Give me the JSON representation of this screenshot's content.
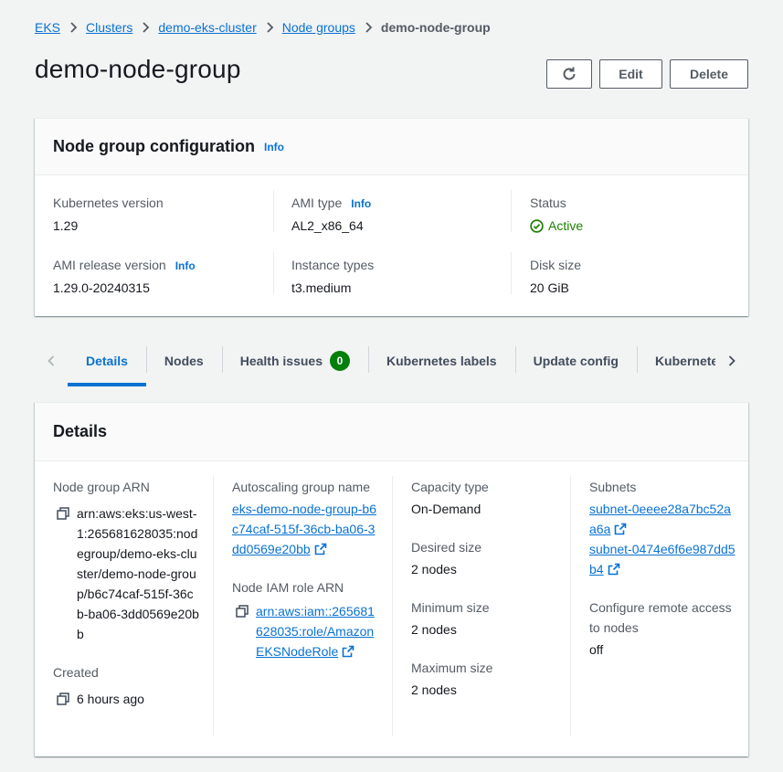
{
  "breadcrumb": {
    "items": [
      "EKS",
      "Clusters",
      "demo-eks-cluster",
      "Node groups"
    ],
    "current": "demo-node-group"
  },
  "header": {
    "title": "demo-node-group",
    "edit_label": "Edit",
    "delete_label": "Delete",
    "refresh_icon": "refresh-icon"
  },
  "config": {
    "title": "Node group configuration",
    "info": "Info",
    "kubernetes_version_label": "Kubernetes version",
    "kubernetes_version": "1.29",
    "ami_type_label": "AMI type",
    "ami_type_info": "Info",
    "ami_type": "AL2_x86_64",
    "status_label": "Status",
    "status": "Active",
    "ami_release_label": "AMI release version",
    "ami_release_info": "Info",
    "ami_release": "1.29.0-20240315",
    "instance_types_label": "Instance types",
    "instance_types": "t3.medium",
    "disk_size_label": "Disk size",
    "disk_size": "20 GiB"
  },
  "tabs": {
    "items": [
      "Details",
      "Nodes",
      "Health issues",
      "Kubernetes labels",
      "Update config",
      "Kubernetes"
    ],
    "health_issues_count": "0",
    "active": "Details"
  },
  "details": {
    "title": "Details",
    "arn_label": "Node group ARN",
    "arn": "arn:aws:eks:us-west-1:265681628035:nodegroup/demo-eks-cluster/demo-node-group/b6c74caf-515f-36cb-ba06-3dd0569e20bb",
    "created_label": "Created",
    "created": "6 hours ago",
    "asg_label": "Autoscaling group name",
    "asg_name": "eks-demo-node-group-b6c74caf-515f-36cb-ba06-3dd0569e20bb",
    "iam_label": "Node IAM role ARN",
    "iam_role": "arn:aws:iam::265681628035:role/AmazonEKSNodeRole",
    "capacity_label": "Capacity type",
    "capacity": "On-Demand",
    "desired_label": "Desired size",
    "desired": "2 nodes",
    "min_label": "Minimum size",
    "min": "2 nodes",
    "max_label": "Maximum size",
    "max": "2 nodes",
    "subnets_label": "Subnets",
    "subnets": [
      "subnet-0eeee28a7bc52aa6a",
      "subnet-0474e6f6e987dd5b4"
    ],
    "remote_access_label": "Configure remote access to nodes",
    "remote_access": "off"
  },
  "colors": {
    "link": "#0972d3",
    "active_status": "#1d8102",
    "badge": "#037f0c"
  }
}
